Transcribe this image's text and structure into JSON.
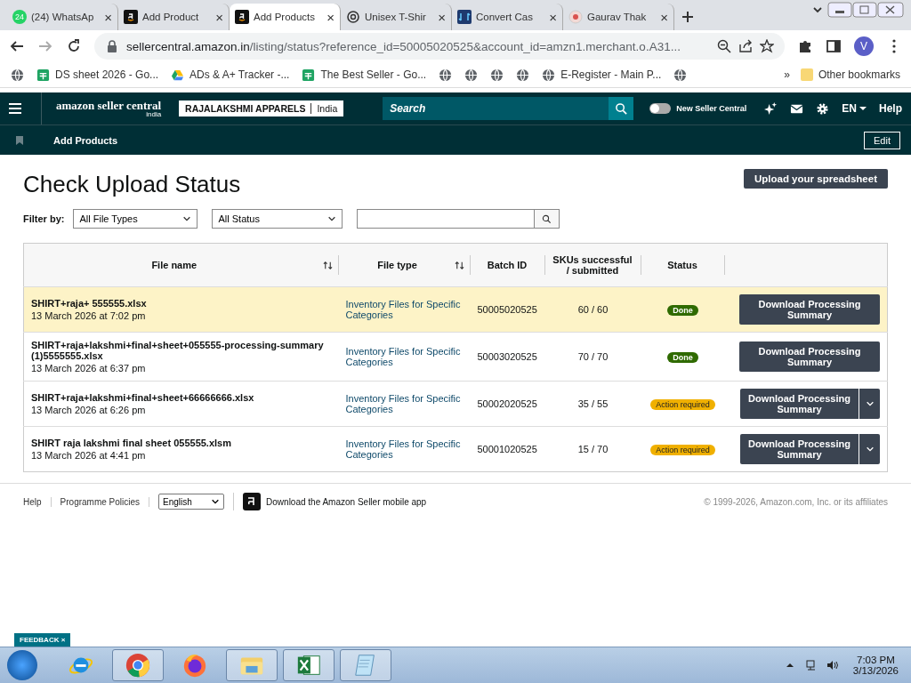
{
  "browser": {
    "tabs": [
      {
        "title": "(24) WhatsAp",
        "kind": "whatsapp",
        "badge": "24",
        "close": "×",
        "selected": false
      },
      {
        "title": "Add Product",
        "kind": "amazon",
        "close": "×",
        "selected": false
      },
      {
        "title": "Add Products",
        "kind": "amazon",
        "close": "×",
        "selected": true
      },
      {
        "title": "Unisex T-Shir",
        "kind": "openai",
        "close": "×",
        "selected": false
      },
      {
        "title": "Convert Cas",
        "kind": "convert",
        "close": "×",
        "selected": false
      },
      {
        "title": "Gaurav Thak",
        "kind": "circle",
        "close": "×",
        "selected": false
      }
    ],
    "url_host": "sellercentral.amazon.in",
    "url_path": "/listing/status?reference_id=50005020525&account_id=amzn1.merchant.o.A31...",
    "profile": "V",
    "bookmarks": [
      {
        "kind": "globe"
      },
      {
        "kind": "sheet",
        "label": "DS sheet 2026 - Go..."
      },
      {
        "kind": "drive",
        "label": "ADs & A+ Tracker -..."
      },
      {
        "kind": "sheet",
        "label": "The Best Seller - Go..."
      },
      {
        "kind": "globe"
      },
      {
        "kind": "globe"
      },
      {
        "kind": "globe"
      },
      {
        "kind": "globe"
      },
      {
        "kind": "globe",
        "label": "E-Register - Main P..."
      },
      {
        "kind": "globe"
      }
    ],
    "more": "»",
    "other_bookmarks": "Other bookmarks"
  },
  "header": {
    "logo": "amazon seller central",
    "logo_region": "india",
    "store": "RAJALAKSHMI APPARELS",
    "marketplace": "India",
    "search_placeholder": "Search",
    "toggle_label": "New Seller Central",
    "toggle_on": false,
    "language": "EN",
    "help": "Help"
  },
  "subnav": {
    "item": "Add Products",
    "edit": "Edit"
  },
  "page": {
    "title": "Check Upload Status",
    "upload_button": "Upload your spreadsheet",
    "filter_label": "Filter by:",
    "filters": [
      "All File Types",
      "All Status"
    ]
  },
  "table": {
    "columns": [
      {
        "label": "File name",
        "sortable": true
      },
      {
        "label": "File type",
        "sortable": true
      },
      {
        "label": "Batch ID",
        "sortable": false
      },
      {
        "label": "SKUs successful / submitted",
        "sortable": false
      },
      {
        "label": "Status",
        "sortable": false
      }
    ],
    "rows": [
      {
        "selected": true,
        "file": "SHIRT+raja+ 555555.xlsx",
        "date": "13 March 2026 at 7:02 pm",
        "file_type": "Inventory Files for Specific Categories",
        "batch_id": "50005020525",
        "skus": "60 / 60",
        "status": "Done",
        "kind": "done",
        "action": "Download Processing Summary",
        "has_menu": false
      },
      {
        "selected": false,
        "file": "SHIRT+raja+lakshmi+final+sheet+055555-processing-summary (1)5555555.xlsx",
        "date": "13 March 2026 at 6:37 pm",
        "file_type": "Inventory Files for Specific Categories",
        "batch_id": "50003020525",
        "skus": "70 / 70",
        "status": "Done",
        "kind": "done",
        "action": "Download Processing Summary",
        "has_menu": false
      },
      {
        "selected": false,
        "file": "SHIRT+raja+lakshmi+final+sheet+66666666.xlsx",
        "date": "13 March 2026 at 6:26 pm",
        "file_type": "Inventory Files for Specific Categories",
        "batch_id": "50002020525",
        "skus": "35 / 55",
        "status": "Action required",
        "kind": "warning",
        "action": "Download Processing Summary",
        "has_menu": true
      },
      {
        "selected": false,
        "file": "SHIRT raja lakshmi final sheet 055555.xlsm",
        "date": "13 March 2026 at 4:41 pm",
        "file_type": "Inventory Files for Specific Categories",
        "batch_id": "50001020525",
        "skus": "15 / 70",
        "status": "Action required",
        "kind": "warning",
        "action": "Download Processing Summary",
        "has_menu": true
      }
    ]
  },
  "footer": {
    "links": [
      "Help",
      "Programme Policies"
    ],
    "language": "English",
    "app_link": "Download the Amazon Seller mobile app",
    "copyright": "© 1999-2026, Amazon.com, Inc. or its affiliates"
  },
  "feedback": "FEEDBACK",
  "feedback_close": "×",
  "taskbar": {
    "apps": [
      {
        "kind": "ie",
        "active": false
      },
      {
        "kind": "chrome",
        "active": true
      },
      {
        "kind": "firefox",
        "active": false
      },
      {
        "kind": "explorer",
        "active": true
      },
      {
        "kind": "excel",
        "active": true
      },
      {
        "kind": "notepad",
        "active": true
      }
    ],
    "time": "7:03 PM",
    "date": "3/13/2026"
  }
}
